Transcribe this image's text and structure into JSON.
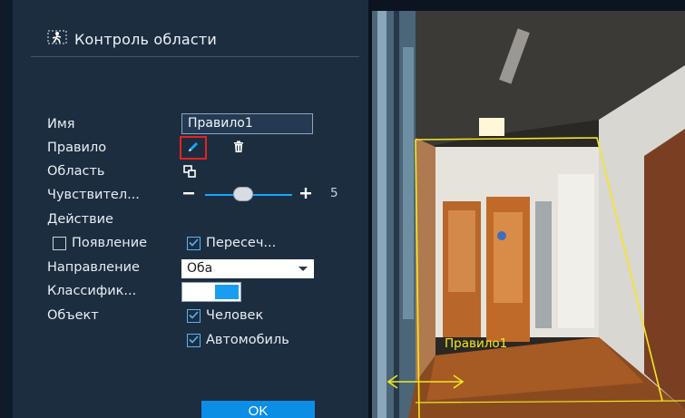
{
  "panel": {
    "title": "Контроль области",
    "fields": {
      "name_label": "Имя",
      "name_value": "Правило1",
      "rule_label": "Правило",
      "area_label": "Область",
      "sensitivity_label": "Чувствител...",
      "sensitivity_value": "5",
      "sensitivity_level_of_10": 5,
      "action_label": "Действие",
      "appear_label": "Появление",
      "appear_checked": false,
      "cross_label": "Пересеч...",
      "cross_checked": true,
      "direction_label": "Направление",
      "direction_value": "Оба",
      "classify_label": "Классифик...",
      "classify_on": true,
      "object_label": "Объект",
      "human_label": "Человек",
      "human_checked": true,
      "vehicle_label": "Автомобиль",
      "vehicle_checked": true
    },
    "ok_label": "OK"
  },
  "camera": {
    "rule_overlay_label": "Правило1",
    "overlay_color": "#f2e820"
  },
  "icons": {
    "title": "intrusion-person-icon",
    "edit": "pencil-icon",
    "delete": "trash-icon",
    "area": "area-draw-icon",
    "minus": "minus-icon",
    "plus": "plus-icon",
    "check": "checkmark-icon",
    "caret": "caret-down-icon",
    "direction_arrow": "double-arrow-icon"
  },
  "colors": {
    "panel_bg": "#1c2d40",
    "accent": "#1a9cf0",
    "highlight_border": "#e62222"
  }
}
